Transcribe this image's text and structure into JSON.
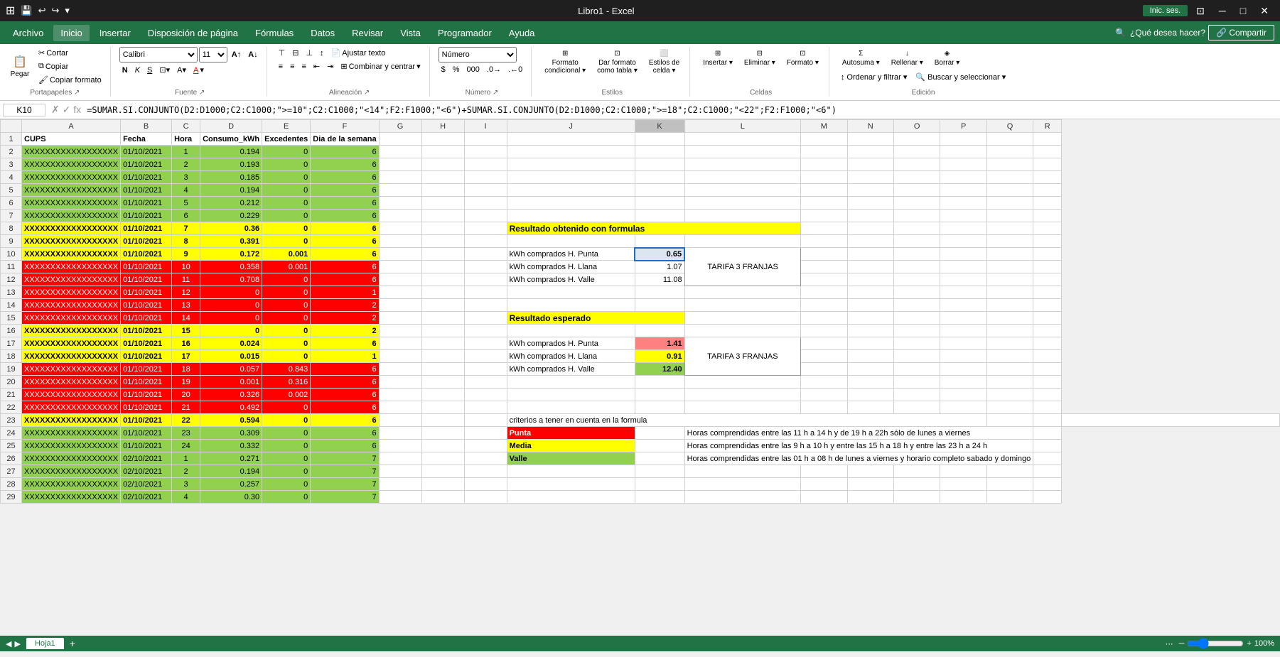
{
  "titleBar": {
    "title": "Libro1 - Excel",
    "initSession": "Inic. ses.",
    "controls": [
      "─",
      "□",
      "✕"
    ]
  },
  "menuBar": {
    "items": [
      "Archivo",
      "Inicio",
      "Insertar",
      "Disposición de página",
      "Fórmulas",
      "Datos",
      "Revisar",
      "Vista",
      "Programador",
      "Ayuda"
    ],
    "activeItem": "Inicio",
    "search": "¿Qué desea hacer?",
    "share": "Compartir"
  },
  "ribbon": {
    "fontName": "Calibri",
    "fontSize": "11",
    "numberFormat": "Número",
    "groups": [
      "Portapapeles",
      "Fuente",
      "Alineación",
      "Número",
      "Estilos",
      "Celdas",
      "Edición"
    ],
    "buttons": {
      "paste": "Pegar",
      "ajustarTexto": "Ajustar texto",
      "combinarCentrar": "Combinar y centrar",
      "formatoCondicional": "Formato condicional",
      "darFormatoTabla": "Dar formato como tabla",
      "estilosCelda": "Estilos de celda",
      "insertar": "Insertar",
      "eliminar": "Eliminar",
      "formato": "Formato",
      "autosuma": "Autosuma",
      "rellenar": "Rellenar",
      "borrar": "Borrar",
      "ordenarFiltrar": "Ordenar y filtrar",
      "buscarSeleccionar": "Buscar y seleccionar"
    }
  },
  "formulaBar": {
    "cellRef": "K10",
    "formula": "=SUMAR.SI.CONJUNTO(D2:D1000;C2:C1000;\">=\"10\";C2:C1000;\"<14\";F2:F1000;\"<6\")+SUMAR.SI.CONJUNTO(D2:D1000;C2:C1000;\">=\"18\";C2:C1000;\"<22\";F2:F1000;\"<6\")"
  },
  "columns": {
    "headers": [
      "A",
      "B",
      "C",
      "D",
      "E",
      "F",
      "G",
      "H",
      "I",
      "J",
      "K",
      "L",
      "M",
      "N",
      "O",
      "P",
      "Q",
      "R"
    ],
    "widths": [
      130,
      72,
      40,
      80,
      65,
      80,
      60,
      60,
      60,
      180,
      70,
      120,
      60,
      60,
      60,
      60,
      60,
      40
    ]
  },
  "headerRow": {
    "A": "CUPS",
    "B": "Fecha",
    "C": "Hora",
    "D": "Consumo_kWh",
    "E": "Excedentes",
    "F": "Dia de la semana"
  },
  "dataRows": [
    {
      "rowNum": 2,
      "A": "XXXXXXXXXXXXXXXXXX",
      "B": "01/10/2021",
      "C": "1",
      "D": "0.194",
      "E": "0",
      "F": "6",
      "color": "green"
    },
    {
      "rowNum": 3,
      "A": "XXXXXXXXXXXXXXXXXX",
      "B": "01/10/2021",
      "C": "2",
      "D": "0.193",
      "E": "0",
      "F": "6",
      "color": "green"
    },
    {
      "rowNum": 4,
      "A": "XXXXXXXXXXXXXXXXXX",
      "B": "01/10/2021",
      "C": "3",
      "D": "0.185",
      "E": "0",
      "F": "6",
      "color": "green"
    },
    {
      "rowNum": 5,
      "A": "XXXXXXXXXXXXXXXXXX",
      "B": "01/10/2021",
      "C": "4",
      "D": "0.194",
      "E": "0",
      "F": "6",
      "color": "green"
    },
    {
      "rowNum": 6,
      "A": "XXXXXXXXXXXXXXXXXX",
      "B": "01/10/2021",
      "C": "5",
      "D": "0.212",
      "E": "0",
      "F": "6",
      "color": "green"
    },
    {
      "rowNum": 7,
      "A": "XXXXXXXXXXXXXXXXXX",
      "B": "01/10/2021",
      "C": "6",
      "D": "0.229",
      "E": "0",
      "F": "6",
      "color": "green"
    },
    {
      "rowNum": 8,
      "A": "XXXXXXXXXXXXXXXXXX",
      "B": "01/10/2021",
      "C": "7",
      "D": "0.36",
      "E": "0",
      "F": "6",
      "color": "yellow"
    },
    {
      "rowNum": 9,
      "A": "XXXXXXXXXXXXXXXXXX",
      "B": "01/10/2021",
      "C": "8",
      "D": "0.391",
      "E": "0",
      "F": "6",
      "color": "yellow"
    },
    {
      "rowNum": 10,
      "A": "XXXXXXXXXXXXXXXXXX",
      "B": "01/10/2021",
      "C": "9",
      "D": "0.172",
      "E": "0.001",
      "F": "6",
      "color": "yellow"
    },
    {
      "rowNum": 11,
      "A": "XXXXXXXXXXXXXXXXXX",
      "B": "01/10/2021",
      "C": "10",
      "D": "0.358",
      "E": "0.001",
      "F": "6",
      "color": "red"
    },
    {
      "rowNum": 12,
      "A": "XXXXXXXXXXXXXXXXXX",
      "B": "01/10/2021",
      "C": "11",
      "D": "0.708",
      "E": "0",
      "F": "6",
      "color": "red"
    },
    {
      "rowNum": 13,
      "A": "XXXXXXXXXXXXXXXXXX",
      "B": "01/10/2021",
      "C": "12",
      "D": "0",
      "E": "0",
      "F": "1",
      "color": "red"
    },
    {
      "rowNum": 14,
      "A": "XXXXXXXXXXXXXXXXXX",
      "B": "01/10/2021",
      "C": "13",
      "D": "0",
      "E": "0",
      "F": "2",
      "color": "red"
    },
    {
      "rowNum": 15,
      "A": "XXXXXXXXXXXXXXXXXX",
      "B": "01/10/2021",
      "C": "14",
      "D": "0",
      "E": "0",
      "F": "2",
      "color": "red"
    },
    {
      "rowNum": 16,
      "A": "XXXXXXXXXXXXXXXXXX",
      "B": "01/10/2021",
      "C": "15",
      "D": "0",
      "E": "0",
      "F": "2",
      "color": "yellow"
    },
    {
      "rowNum": 17,
      "A": "XXXXXXXXXXXXXXXXXX",
      "B": "01/10/2021",
      "C": "16",
      "D": "0.024",
      "E": "0",
      "F": "6",
      "color": "yellow"
    },
    {
      "rowNum": 18,
      "A": "XXXXXXXXXXXXXXXXXX",
      "B": "01/10/2021",
      "C": "17",
      "D": "0.015",
      "E": "0",
      "F": "1",
      "color": "yellow"
    },
    {
      "rowNum": 19,
      "A": "XXXXXXXXXXXXXXXXXX",
      "B": "01/10/2021",
      "C": "18",
      "D": "0.057",
      "E": "0.843",
      "F": "6",
      "color": "red"
    },
    {
      "rowNum": 20,
      "A": "XXXXXXXXXXXXXXXXXX",
      "B": "01/10/2021",
      "C": "19",
      "D": "0.001",
      "E": "0.316",
      "F": "6",
      "color": "red"
    },
    {
      "rowNum": 21,
      "A": "XXXXXXXXXXXXXXXXXX",
      "B": "01/10/2021",
      "C": "20",
      "D": "0.326",
      "E": "0.002",
      "F": "6",
      "color": "red"
    },
    {
      "rowNum": 22,
      "A": "XXXXXXXXXXXXXXXXXX",
      "B": "01/10/2021",
      "C": "21",
      "D": "0.492",
      "E": "0",
      "F": "6",
      "color": "red"
    },
    {
      "rowNum": 23,
      "A": "XXXXXXXXXXXXXXXXXX",
      "B": "01/10/2021",
      "C": "22",
      "D": "0.594",
      "E": "0",
      "F": "6",
      "color": "yellow"
    },
    {
      "rowNum": 24,
      "A": "XXXXXXXXXXXXXXXXXX",
      "B": "01/10/2021",
      "C": "23",
      "D": "0.309",
      "E": "0",
      "F": "6",
      "color": "green"
    },
    {
      "rowNum": 25,
      "A": "XXXXXXXXXXXXXXXXXX",
      "B": "01/10/2021",
      "C": "24",
      "D": "0.332",
      "E": "0",
      "F": "6",
      "color": "green"
    },
    {
      "rowNum": 26,
      "A": "XXXXXXXXXXXXXXXXXX",
      "B": "02/10/2021",
      "C": "1",
      "D": "0.271",
      "E": "0",
      "F": "7",
      "color": "green"
    },
    {
      "rowNum": 27,
      "A": "XXXXXXXXXXXXXXXXXX",
      "B": "02/10/2021",
      "C": "2",
      "D": "0.194",
      "E": "0",
      "F": "7",
      "color": "green"
    },
    {
      "rowNum": 28,
      "A": "XXXXXXXXXXXXXXXXXX",
      "B": "02/10/2021",
      "C": "3",
      "D": "0.257",
      "E": "0",
      "F": "7",
      "color": "green"
    },
    {
      "rowNum": 29,
      "A": "XXXXXXXXXXXXXXXXXX",
      "B": "02/10/2021",
      "C": "4",
      "D": "0.30",
      "E": "0",
      "F": "7",
      "color": "green"
    }
  ],
  "sidePanel": {
    "resultadoFormulas": {
      "title": "Resultado obtenido con formulas",
      "rows": [
        {
          "label": "kWh comprados H. Punta",
          "value": "0.65",
          "valueColor": "white"
        },
        {
          "label": "kWh comprados H. Llana",
          "value": "1.07",
          "valueColor": "white"
        },
        {
          "label": "kWh comprados H. Valle",
          "value": "11.08",
          "valueColor": "white"
        }
      ],
      "tarifa": "TARIFA 3 FRANJAS"
    },
    "resultadoEsperado": {
      "title": "Resultado esperado",
      "rows": [
        {
          "label": "kWh comprados H. Punta",
          "value": "1.41",
          "valueColor": "red"
        },
        {
          "label": "kWh comprados H. Llana",
          "value": "0.91",
          "valueColor": "yellow"
        },
        {
          "label": "kWh comprados H. Valle",
          "value": "12.40",
          "valueColor": "green"
        }
      ],
      "tarifa": "TARIFA 3 FRANJAS"
    },
    "criterios": {
      "title": "criterios a tener en cuenta en la formula",
      "items": [
        {
          "label": "Punta",
          "color": "red",
          "desc": "Horas comprendidas entre las 11 h a 14 h y de 19 h a 22h sólo de lunes a viernes"
        },
        {
          "label": "Media",
          "color": "yellow",
          "desc": "Horas comprendidas entre las 9 h a 10 h y entre las 15 h a 18 h y entre las 23 h a 24 h"
        },
        {
          "label": "Valle",
          "color": "green",
          "desc": "Horas comprendidas entre las 01 h a 08 h de lunes a viernes y horario completo sabado y domingo"
        }
      ]
    }
  },
  "bottomBar": {
    "sheetName": "Hoja1"
  }
}
